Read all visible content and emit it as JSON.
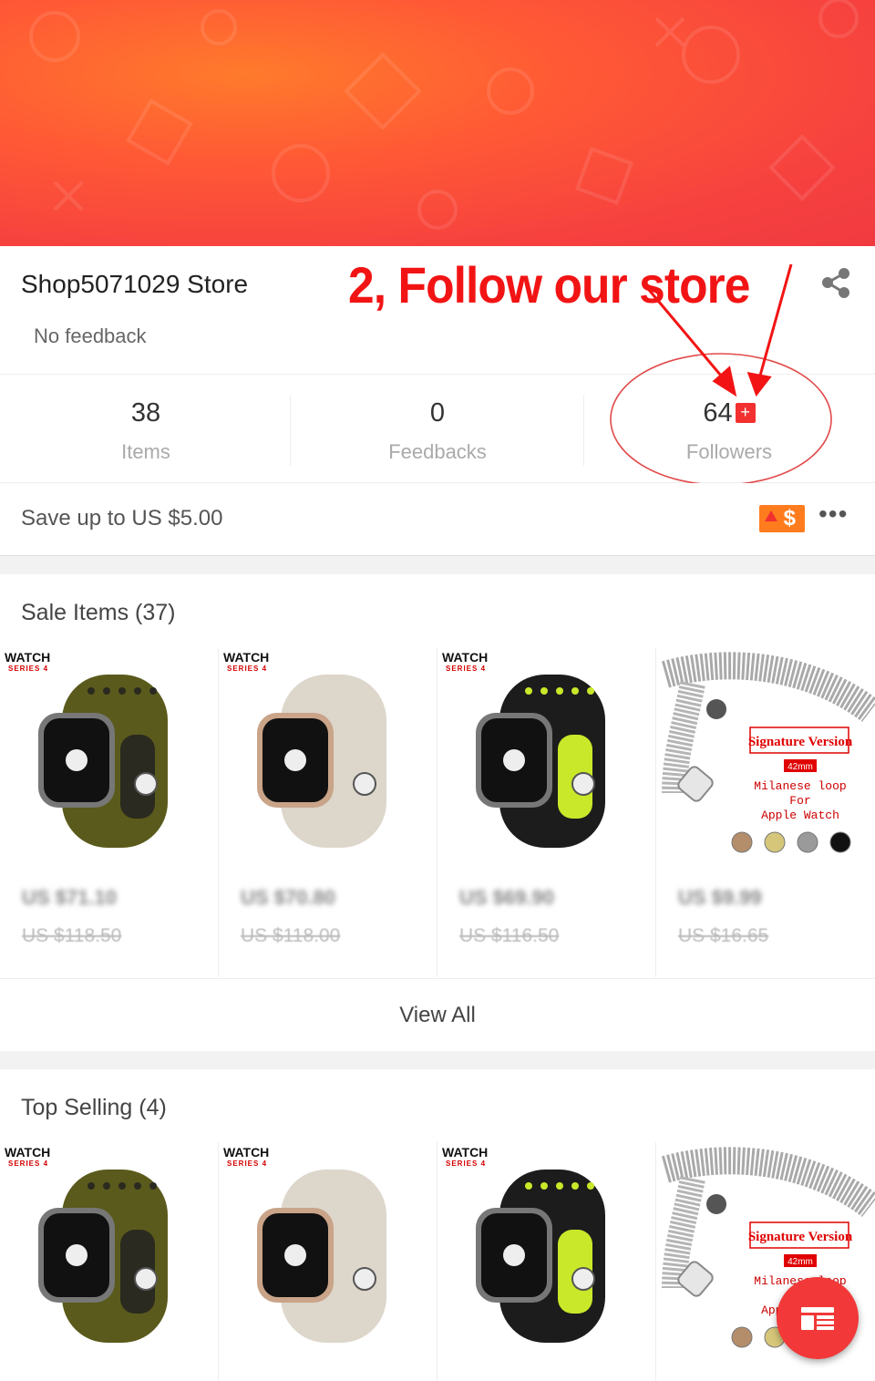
{
  "store": {
    "name": "Shop5071029 Store",
    "feedback_status": "No feedback"
  },
  "annotation": {
    "text": "2, Follow our store"
  },
  "stats": [
    {
      "value": "38",
      "label": "Items"
    },
    {
      "value": "0",
      "label": "Feedbacks"
    },
    {
      "value": "64",
      "label": "Followers",
      "follow_symbol": "+"
    }
  ],
  "coupon": {
    "text": "Save up to US $5.00",
    "icon_glyph": "$",
    "more_glyph": "•••"
  },
  "sale_items": {
    "title": "Sale Items (37)",
    "products": [
      {
        "tag": "WATCH",
        "tag_sub": "SERIES 4",
        "band_color": "#5a5a1c",
        "accent": "#2a2a20",
        "price": "US $71.10",
        "original_price": "US $118.50"
      },
      {
        "tag": "WATCH",
        "tag_sub": "SERIES 4",
        "band_color": "#ddd6cb",
        "accent": "#c9a489",
        "price": "US $70.80",
        "original_price": "US $118.00"
      },
      {
        "tag": "WATCH",
        "tag_sub": "SERIES 4",
        "band_color": "#1c1c1c",
        "accent": "#c9e82a",
        "price": "US $69.90",
        "original_price": "US $116.50"
      },
      {
        "tag": "",
        "tag_sub": "",
        "band_color": "#b9b9b9",
        "accent": "#e00000",
        "price": "US $9.99",
        "original_price": "US $16.65",
        "milanese": {
          "title": "Signature Version",
          "size": "42mm",
          "line1": "Milanese loop",
          "line2": "For",
          "line3": "Apple Watch"
        }
      }
    ]
  },
  "view_all": "View All",
  "top_selling": {
    "title": "Top Selling (4)",
    "products": [
      {
        "tag": "WATCH",
        "tag_sub": "SERIES 4",
        "band_color": "#5a5a1c",
        "accent": "#2a2a20"
      },
      {
        "tag": "WATCH",
        "tag_sub": "SERIES 4",
        "band_color": "#ddd6cb",
        "accent": "#c9a489"
      },
      {
        "tag": "WATCH",
        "tag_sub": "SERIES 4",
        "band_color": "#1c1c1c",
        "accent": "#c9e82a"
      },
      {
        "tag": "",
        "tag_sub": "",
        "band_color": "#b9b9b9",
        "accent": "#e00000",
        "milanese": {
          "title": "Signature Version",
          "size": "42mm",
          "line1": "Milanese loop",
          "line2": "For",
          "line3": "Apple Watch"
        }
      }
    ]
  },
  "colors": {
    "brand_red": "#f23030",
    "annotation_red": "#f21414",
    "coupon_orange": "#ff7c1e"
  }
}
